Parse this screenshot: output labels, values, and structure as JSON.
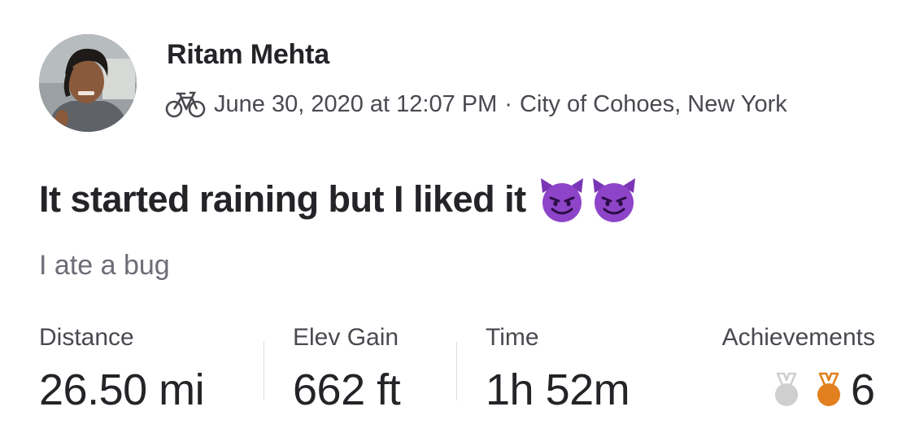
{
  "athlete": {
    "name": "Ritam Mehta",
    "avatar_icon": "profile-photo"
  },
  "activity": {
    "type_icon": "bicycle-icon",
    "date_time": "June 30, 2020 at 12:07 PM",
    "separator": "·",
    "location": "City of Cohoes, New York",
    "title": "It started raining but I liked it",
    "title_emoji": [
      "smiling-devil-emoji",
      "smiling-devil-emoji"
    ],
    "description": "I ate a bug"
  },
  "stats": {
    "distance": {
      "label": "Distance",
      "value": "26.50 mi"
    },
    "elev_gain": {
      "label": "Elev Gain",
      "value": "662 ft"
    },
    "time": {
      "label": "Time",
      "value": "1h 52m"
    },
    "achievements": {
      "label": "Achievements",
      "count": "6",
      "medals": [
        "silver-medal-icon",
        "bronze-medal-icon"
      ]
    }
  },
  "colors": {
    "text_primary": "#242428",
    "text_secondary": "#494950",
    "text_muted": "#6d6d78",
    "silver_medal": "#cfcfcf",
    "bronze_medal": "#e2801f",
    "devil_purple": "#8e44c9"
  }
}
